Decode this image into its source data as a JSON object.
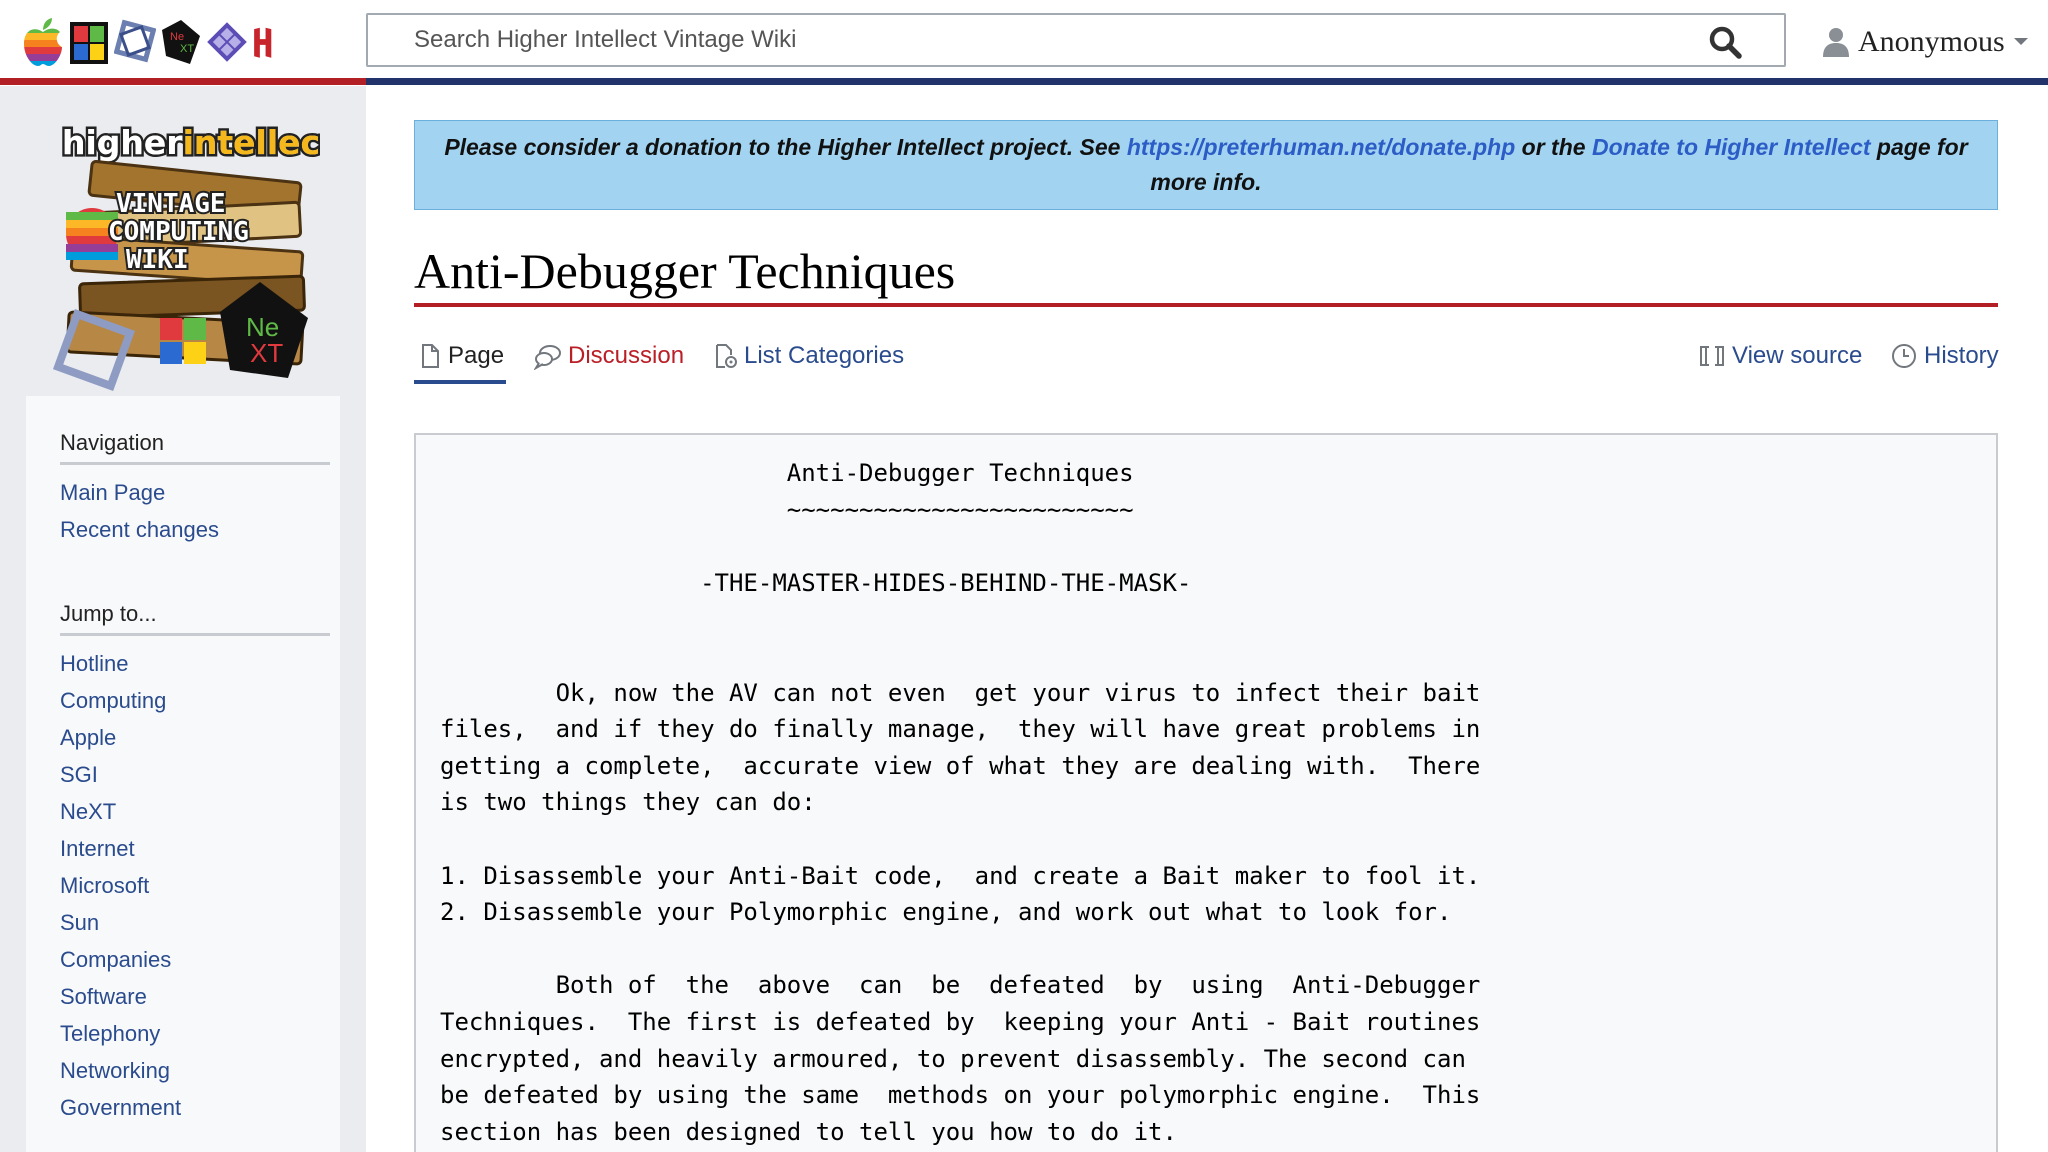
{
  "header": {
    "search_placeholder": "Search Higher Intellect Vintage Wiki",
    "user_name": "Anonymous"
  },
  "logos": [
    "apple-logo",
    "windows-logo",
    "sgi-logo",
    "next-logo",
    "sun-logo",
    "higher-intellect-logo"
  ],
  "sidebar": {
    "navigation": {
      "heading": "Navigation",
      "items": [
        "Main Page",
        "Recent changes"
      ]
    },
    "jump": {
      "heading": "Jump to...",
      "items": [
        "Hotline",
        "Computing",
        "Apple",
        "SGI",
        "NeXT",
        "Internet",
        "Microsoft",
        "Sun",
        "Companies",
        "Software",
        "Telephony",
        "Networking",
        "Government"
      ]
    }
  },
  "banner": {
    "text1": "Please consider a donation to the Higher Intellect project. See ",
    "link1": "https://preterhuman.net/donate.php",
    "text2": " or the ",
    "link2": "Donate to Higher Intellect",
    "text3": " page for more info."
  },
  "page": {
    "title": "Anti-Debugger Techniques",
    "tabs": {
      "page": "Page",
      "discussion": "Discussion",
      "categories": "List Categories",
      "view_source": "View source",
      "history": "History"
    },
    "body": "                        Anti-Debugger Techniques\n                        ~~~~~~~~~~~~~~~~~~~~~~~~\n\n                  -THE-MASTER-HIDES-BEHIND-THE-MASK-\n\n\n        Ok, now the AV can not even  get your virus to infect their bait\nfiles,  and if they do finally manage,  they will have great problems in\ngetting a complete,  accurate view of what they are dealing with.  There\nis two things they can do:\n\n1. Disassemble your Anti-Bait code,  and create a Bait maker to fool it.\n2. Disassemble your Polymorphic engine, and work out what to look for.\n\n        Both of  the  above  can  be  defeated  by  using  Anti-Debugger\nTechniques.  The first is defeated by  keeping your Anti - Bait routines\nencrypted, and heavily armoured, to prevent disassembly. The second can\nbe defeated by using the same  methods on your polymorphic engine.  This\nsection has been designed to tell you how to do it."
  },
  "colors": {
    "accent_red": "#b21f24",
    "accent_blue": "#22336b",
    "link": "#2a4b8d",
    "banner_bg": "#a2d4f2"
  }
}
